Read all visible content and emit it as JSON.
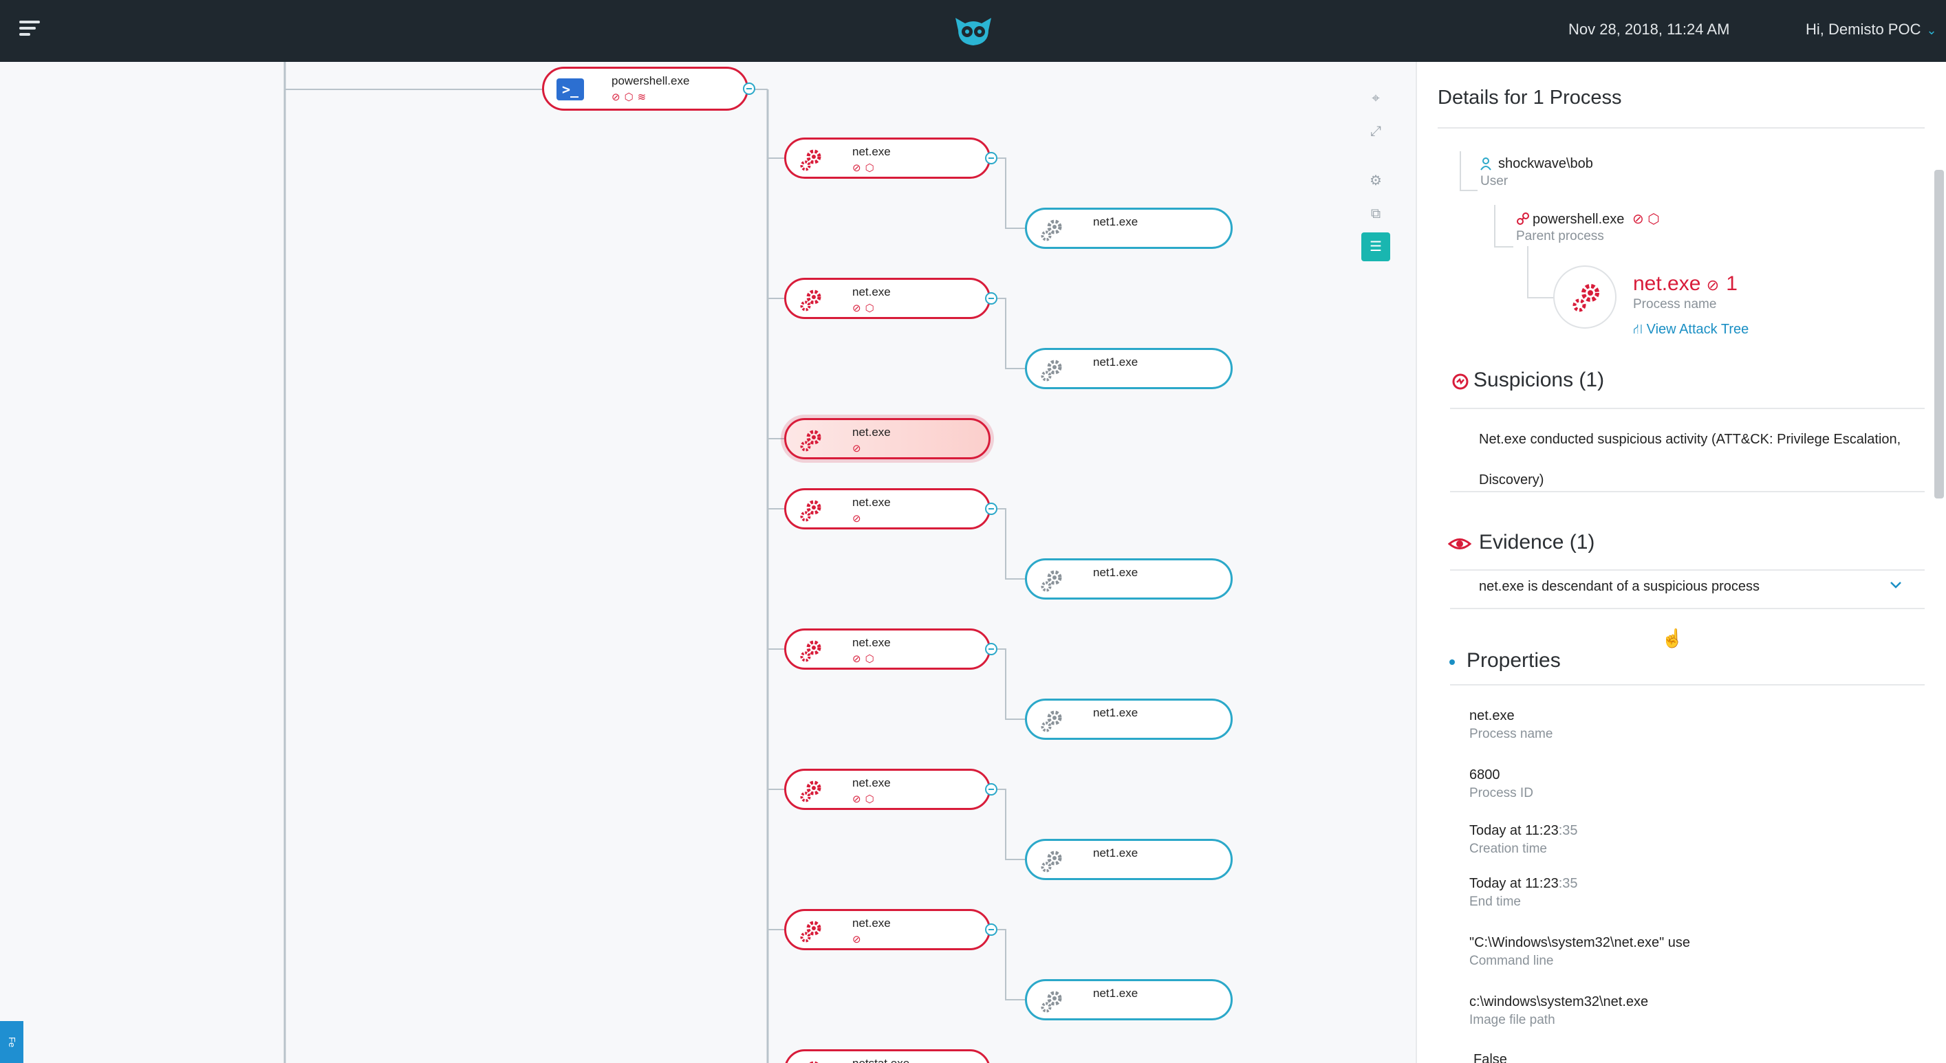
{
  "topbar": {
    "menu_icon": "hamburger-menu-icon",
    "logo_icon": "owl-logo-icon",
    "datetime": "Nov 28, 2018, 11:24 AM",
    "user": "Hi, Demisto POC",
    "user_chevron": "⌄"
  },
  "graph": {
    "root": {
      "label": "powershell.exe",
      "badges": "⊘⬡≋"
    },
    "nodes": [
      {
        "label": "net.exe",
        "badges": "⊘⬡",
        "child": "net1.exe",
        "selected": false
      },
      {
        "label": "net.exe",
        "badges": "⊘⬡",
        "child": "net1.exe",
        "selected": false
      },
      {
        "label": "net.exe",
        "badges": "⊘",
        "child": "",
        "selected": true
      },
      {
        "label": "net.exe",
        "badges": "⊘",
        "child": "net1.exe",
        "selected": false
      },
      {
        "label": "net.exe",
        "badges": "⊘⬡",
        "child": "net1.exe",
        "selected": false
      },
      {
        "label": "net.exe",
        "badges": "⊘⬡",
        "child": "net1.exe",
        "selected": false
      },
      {
        "label": "net.exe",
        "badges": "⊘",
        "child": "net1.exe",
        "selected": false
      },
      {
        "label": "netstat.exe",
        "badges": "",
        "child": "",
        "selected": false
      }
    ],
    "toolbar_icons": [
      "focus-icon",
      "expand-icon",
      "settings-icon",
      "compare-icon",
      "list-icon"
    ],
    "feedback_tab": "Fe"
  },
  "panel": {
    "title": "Details for 1 Process",
    "user": {
      "name": "shockwave\\bob",
      "label": "User"
    },
    "parent": {
      "name": "powershell.exe",
      "badges": "⊘ ⬡",
      "label": "Parent process"
    },
    "process": {
      "name": "net.exe",
      "count": "1",
      "label": "Process name",
      "link": "View Attack Tree"
    },
    "suspicions": {
      "title": "Suspicions (1)",
      "line1": "Net.exe conducted suspicious activity (ATT&CK: Privilege Escalation,",
      "line2": "Discovery)"
    },
    "evidence": {
      "title": "Evidence (1)",
      "item": "net.exe is descendant of a suspicious process"
    },
    "properties": {
      "title": "Properties",
      "items": [
        {
          "value": "net.exe",
          "label": "Process name"
        },
        {
          "value": "6800",
          "label": "Process ID"
        },
        {
          "value": "Today at 11:23",
          "value_dim": ":35",
          "label": "Creation time"
        },
        {
          "value": "Today at 11:23",
          "value_dim": ":35",
          "label": "End time"
        },
        {
          "value": "\"C:\\Windows\\system32\\net.exe\" use",
          "label": "Command line"
        },
        {
          "value": "c:\\windows\\system32\\net.exe",
          "label": "Image file path"
        },
        {
          "value": "False",
          "label": ""
        }
      ]
    }
  },
  "colors": {
    "topbar": "#1f282f",
    "suspicious_red": "#d81c3a",
    "child_blue": "#2ba8c9",
    "link_blue": "#1a8fc4",
    "active_teal": "#19b6b0"
  }
}
